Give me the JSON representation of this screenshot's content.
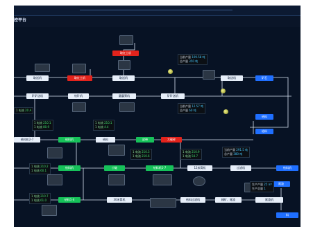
{
  "header": {
    "title": "控平台"
  },
  "nodes": [
    {
      "id": "n1",
      "label": "取送机"
    },
    {
      "id": "n2",
      "label": "取红土机"
    },
    {
      "id": "n3",
      "label": "取红土机"
    },
    {
      "id": "n4",
      "label": "取送机"
    },
    {
      "id": "n5",
      "label": "取送机"
    },
    {
      "id": "n6",
      "label": "矿石"
    },
    {
      "id": "n7",
      "label": "矿矿送机"
    },
    {
      "id": "n8",
      "label": "给矿机"
    },
    {
      "id": "n9",
      "label": "圆震筛机"
    },
    {
      "id": "n10",
      "label": "矿矿送机"
    },
    {
      "id": "n11",
      "label": "给料"
    },
    {
      "id": "n12",
      "label": "给料"
    },
    {
      "id": "n13",
      "label": "给料机2-7"
    },
    {
      "id": "n14",
      "label": "给料机"
    },
    {
      "id": "n15",
      "label": "给料"
    },
    {
      "id": "n16",
      "label": "皮带"
    },
    {
      "id": "n17",
      "label": "大破碎"
    },
    {
      "id": "n18",
      "label": "给料机"
    },
    {
      "id": "n19",
      "label": "小破"
    },
    {
      "id": "n20",
      "label": "给料机1-7"
    },
    {
      "id": "n21",
      "label": "12米筒机"
    },
    {
      "id": "n22",
      "label": "过滤机"
    },
    {
      "id": "n23",
      "label": "给料机"
    },
    {
      "id": "n24",
      "label": "给料1-4"
    },
    {
      "id": "n25",
      "label": "30米筒机"
    },
    {
      "id": "n26",
      "label": "给料过滤机"
    },
    {
      "id": "n27",
      "label": "精矿、尾渣"
    },
    {
      "id": "n28",
      "label": "尾渣"
    },
    {
      "id": "n29",
      "label": "料"
    },
    {
      "id": "n30",
      "label": "尾渣机"
    }
  ],
  "info_boxes": [
    {
      "id": "i1",
      "r1": "当前产量",
      "v1": "109.58 吨",
      "r2": "总产量",
      "v2": "350 吨"
    },
    {
      "id": "i2",
      "r1": "当前产量",
      "v1": "12.57 吨",
      "r2": "总产量",
      "v2": "60 吨"
    },
    {
      "id": "i3",
      "r1": "1 电流",
      "v1": "20 A",
      "r2": "",
      "v2": ""
    },
    {
      "id": "i4",
      "r1": "1 电流",
      "v1": "210.1",
      "r2": "1 电流",
      "v2": "80.9"
    },
    {
      "id": "i5",
      "r1": "1 电流",
      "v1": "210.1",
      "r2": "1 电流",
      "v2": "4.4"
    },
    {
      "id": "i6",
      "r1": "1 电流",
      "v1": "210.3",
      "r2": "1 电流",
      "v2": "210.6"
    },
    {
      "id": "i7",
      "r1": "1 电流",
      "v1": "210.9",
      "r2": "1 电流",
      "v2": "54.7"
    },
    {
      "id": "i8",
      "r1": "当前产量",
      "v1": "291.5 吨",
      "r2": "总产量",
      "v2": "380 吨"
    },
    {
      "id": "i9",
      "r1": "1 电流",
      "v1": "210.2",
      "r2": "1 电流",
      "v2": "60.1"
    },
    {
      "id": "i10",
      "r1": "1 电流",
      "v1": "210.7",
      "r2": "1 电流",
      "v2": "61.0"
    },
    {
      "id": "i11",
      "r1": "生产产量",
      "v1": "25 m³",
      "r2": "生产总量",
      "v2": "1"
    }
  ]
}
